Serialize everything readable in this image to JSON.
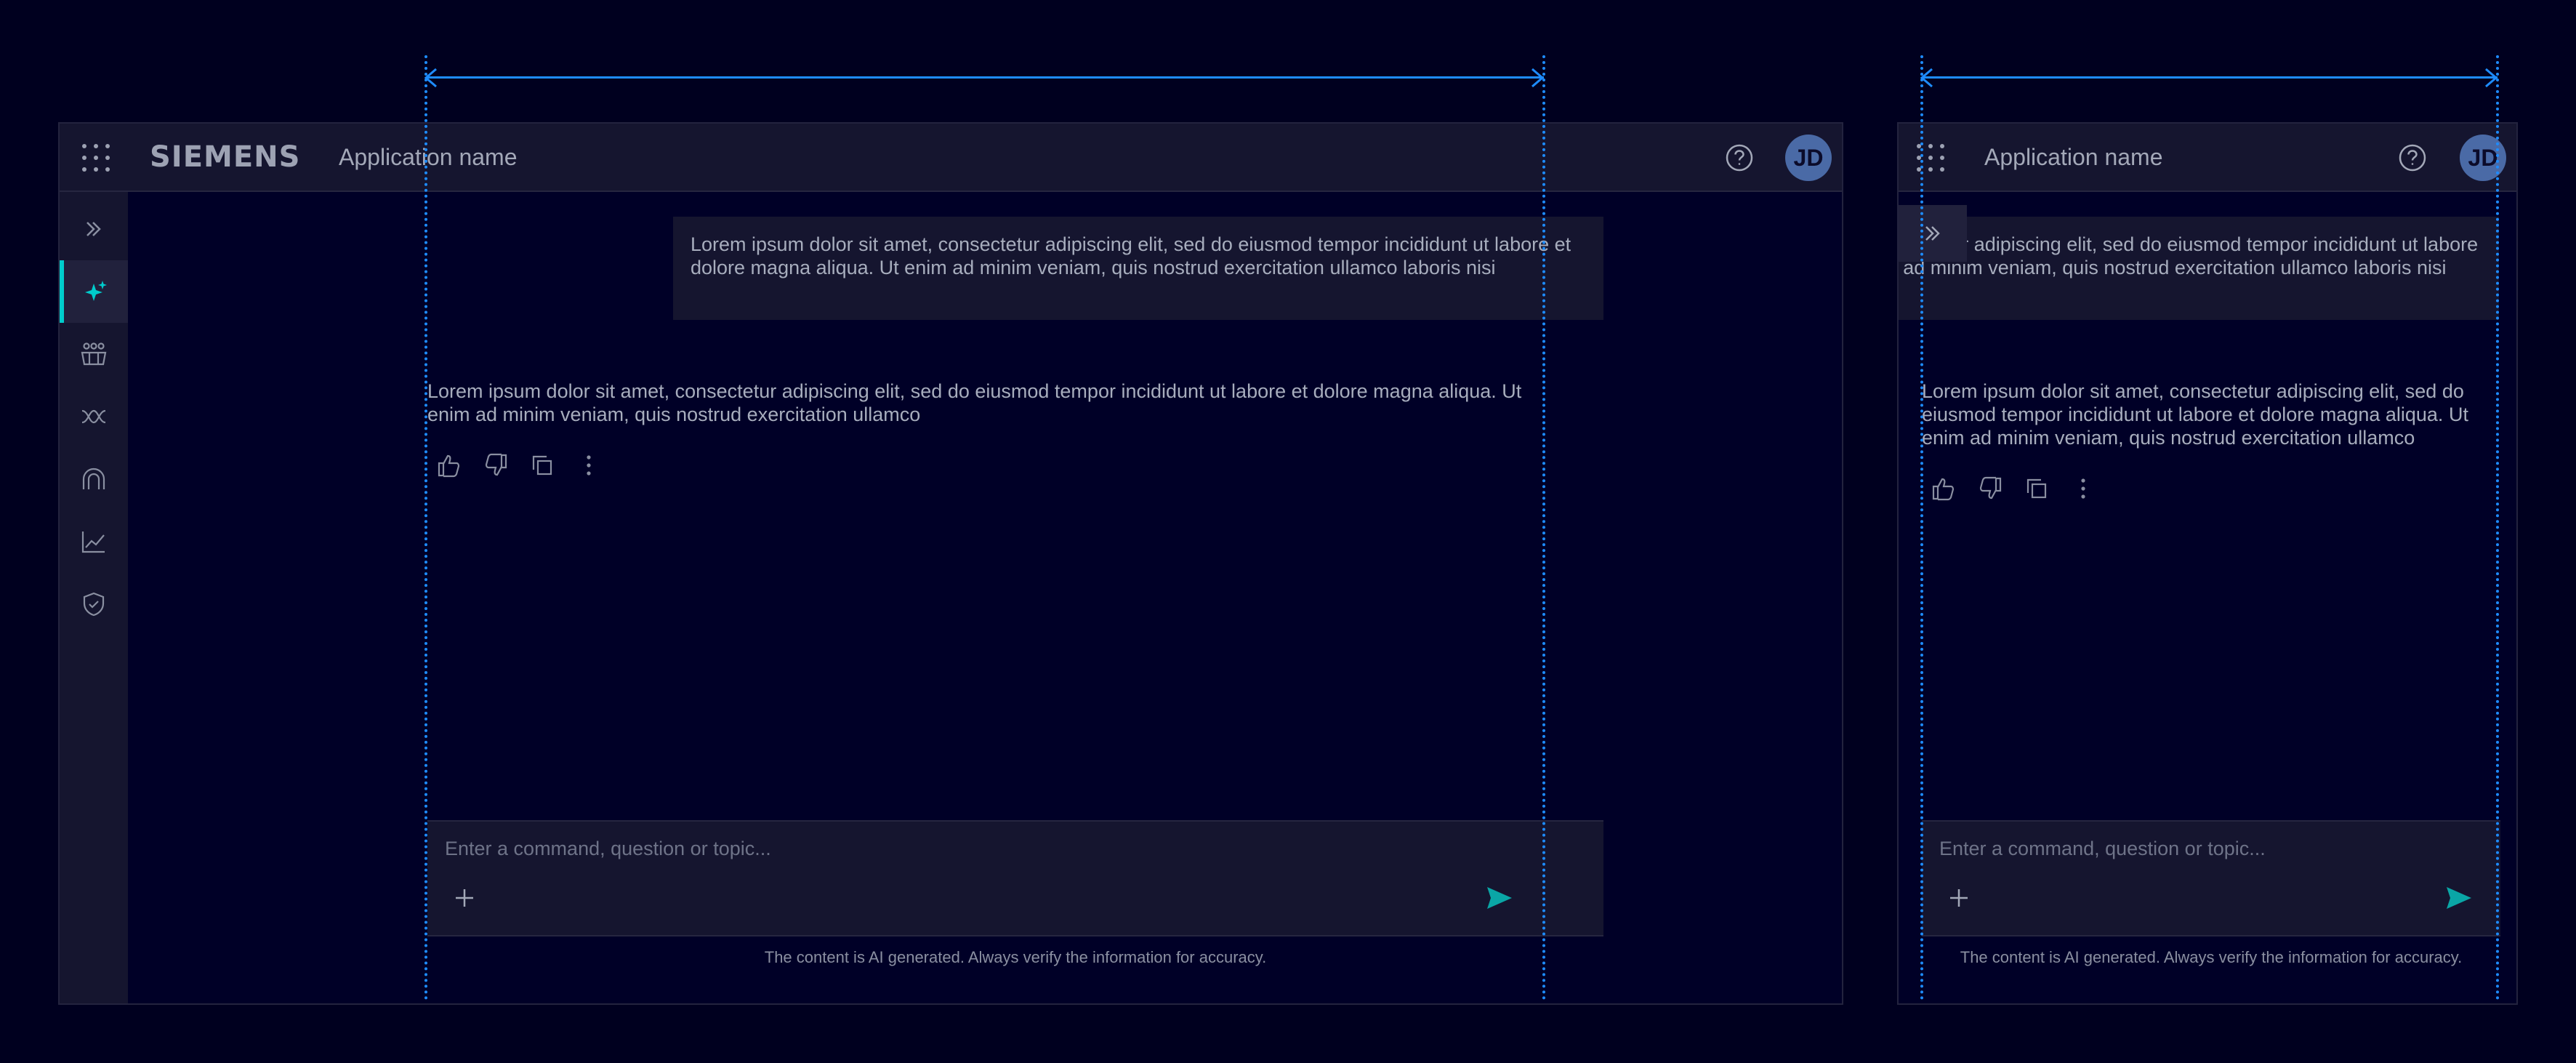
{
  "header": {
    "brand": "SIEMENS",
    "app_name": "Application name",
    "avatar_initials": "JD"
  },
  "sidebar": {
    "items": [
      {
        "icon": "double-chevron-right-icon"
      },
      {
        "icon": "sparkle-icon",
        "active": true
      },
      {
        "icon": "users-icon"
      },
      {
        "icon": "infinity-icon"
      },
      {
        "icon": "rainbow-icon"
      },
      {
        "icon": "line-chart-icon"
      },
      {
        "icon": "shield-check-icon"
      }
    ]
  },
  "chat": {
    "user_message": "Lorem ipsum dolor sit amet, consectetur adipiscing elit, sed do eiusmod tempor incididunt ut labore et dolore magna aliqua. Ut enim ad minim veniam, quis nostrud exercitation ullamco laboris nisi",
    "assistant_message": "Lorem ipsum dolor sit amet, consectetur adipiscing elit, sed do eiusmod tempor incididunt ut labore et dolore magna aliqua. Ut enim ad minim veniam, quis nostrud exercitation ullamco",
    "actions": [
      "thumbs-up-icon",
      "thumbs-down-icon",
      "copy-icon",
      "more-vertical-icon"
    ]
  },
  "composer": {
    "placeholder": "Enter a command, question or topic..."
  },
  "disclaimer": "The content is AI generated. Always verify the information for accuracy.",
  "colors": {
    "background": "#00001f",
    "surface": "#15152f",
    "accent": "#00cccc",
    "guide": "#1e8cff",
    "avatar": "#4a6aa6"
  }
}
